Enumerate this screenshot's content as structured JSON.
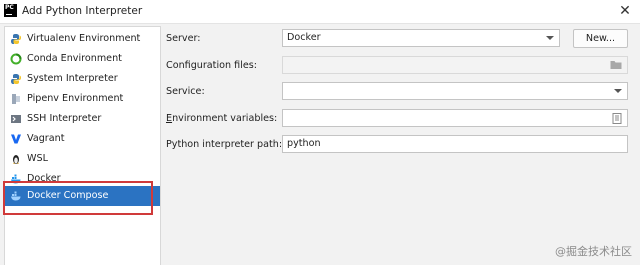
{
  "window": {
    "title": "Add Python Interpreter",
    "logo_text": "PC"
  },
  "sidebar": {
    "items": [
      {
        "label": "Virtualenv Environment",
        "icon": "virtualenv-icon",
        "selected": false
      },
      {
        "label": "Conda Environment",
        "icon": "conda-icon",
        "selected": false
      },
      {
        "label": "System Interpreter",
        "icon": "python-icon",
        "selected": false
      },
      {
        "label": "Pipenv Environment",
        "icon": "pipenv-icon",
        "selected": false
      },
      {
        "label": "SSH Interpreter",
        "icon": "ssh-icon",
        "selected": false
      },
      {
        "label": "Vagrant",
        "icon": "vagrant-icon",
        "selected": false
      },
      {
        "label": "WSL",
        "icon": "linux-icon",
        "selected": false
      },
      {
        "label": "Docker",
        "icon": "docker-icon",
        "selected": false
      },
      {
        "label": "Docker Compose",
        "icon": "docker-compose-icon",
        "selected": true
      }
    ]
  },
  "form": {
    "server_label": "Server:",
    "server_value": "Docker",
    "new_button": "New...",
    "config_label": "Configuration files:",
    "config_value": "",
    "service_label": "Service:",
    "service_value": "",
    "env_label_first": "E",
    "env_label_rest": "nvironment variables:",
    "env_value": "",
    "path_label": "Python interpreter path:",
    "path_value": "python"
  },
  "watermark": "@掘金技术社区",
  "colors": {
    "selection": "#2b73c2",
    "highlight_border": "#d03a3a",
    "vagrant": "#1868f2"
  }
}
